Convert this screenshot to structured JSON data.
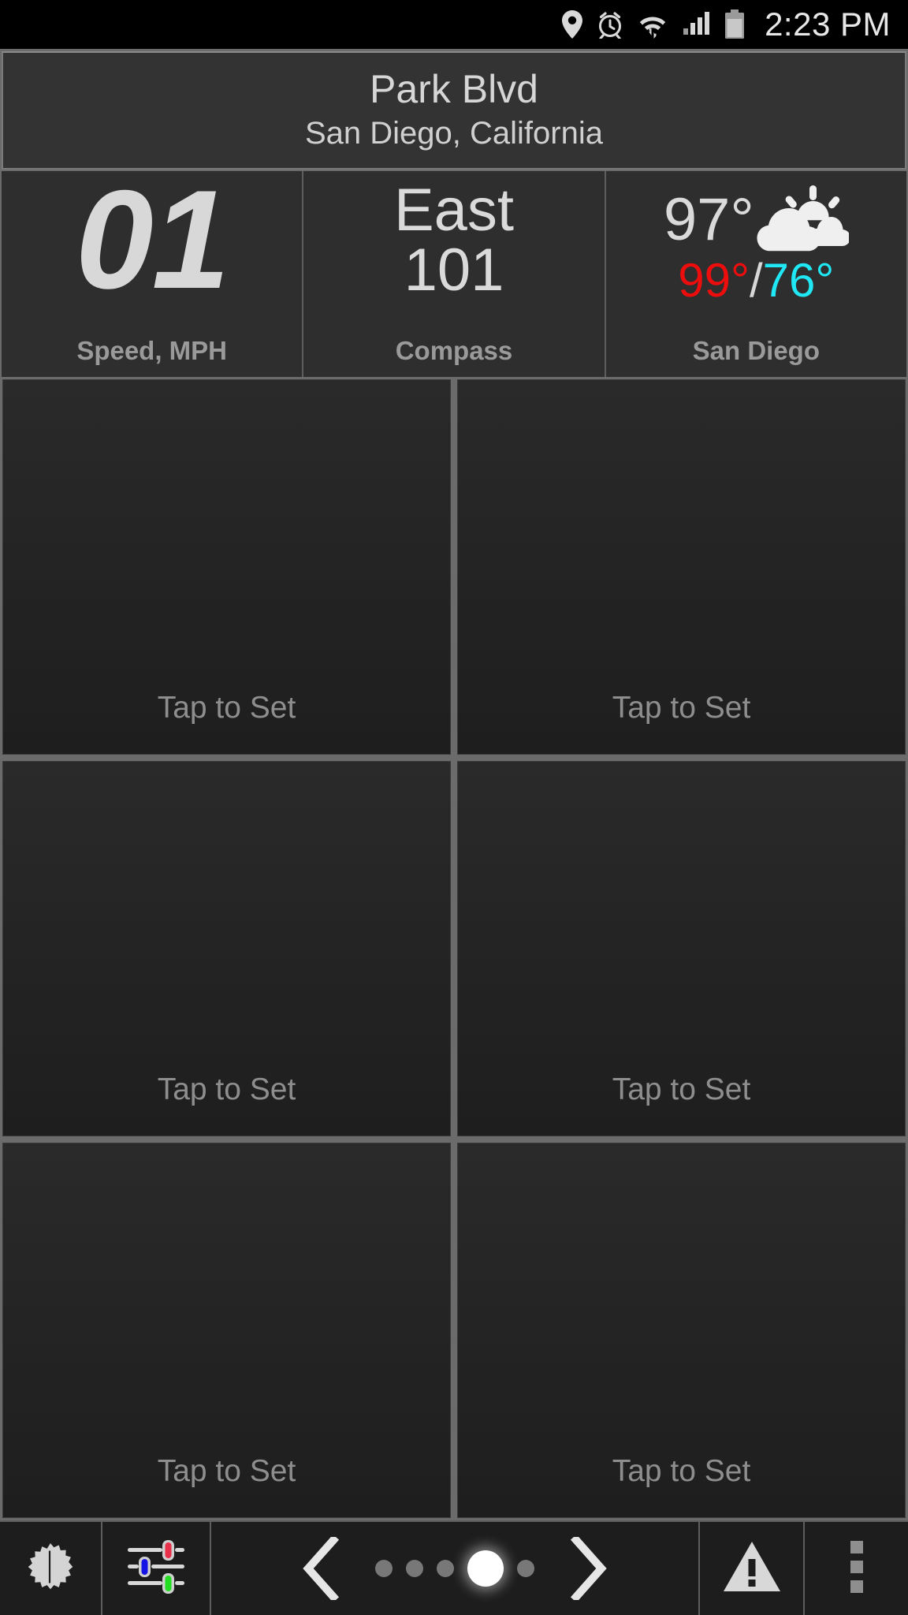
{
  "statusbar": {
    "time": "2:23 PM",
    "icons": [
      "location-pin-icon",
      "alarm-clock-icon",
      "wifi-icon",
      "cell-signal-icon",
      "battery-icon"
    ]
  },
  "header": {
    "title": "Park Blvd",
    "subtitle": "San Diego, California"
  },
  "gauges": [
    {
      "value": "01",
      "label": "Speed, MPH"
    },
    {
      "primary": "East",
      "secondary": "101",
      "label": "Compass"
    },
    {
      "temp": "97°",
      "high": "99°",
      "separator": "/",
      "low": "76°",
      "label": "San Diego",
      "condition_icon": "partly-cloudy-icon"
    }
  ],
  "tiles": [
    {
      "label": "Tap to Set"
    },
    {
      "label": "Tap to Set"
    },
    {
      "label": "Tap to Set"
    },
    {
      "label": "Tap to Set"
    },
    {
      "label": "Tap to Set"
    },
    {
      "label": "Tap to Set"
    }
  ],
  "toolbar": {
    "brightness_icon": "brightness-icon",
    "sliders_icon": "color-sliders-icon",
    "prev_icon": "chevron-left-icon",
    "next_icon": "chevron-right-icon",
    "warning_icon": "warning-triangle-icon",
    "more_icon": "overflow-menu-icon",
    "page_count": 5,
    "page_active_index": 3
  },
  "colors": {
    "accent_high": "#ee0d0d",
    "accent_low": "#20e7f4",
    "panel_bg": "#2e2e2e",
    "tile_bg": "#242424",
    "divider": "#6b6b6b",
    "text_primary": "#d8d8d8",
    "text_muted": "#9a9a9a",
    "slider_red": "#e8304a",
    "slider_blue": "#1414e6",
    "slider_green": "#22dd22"
  }
}
